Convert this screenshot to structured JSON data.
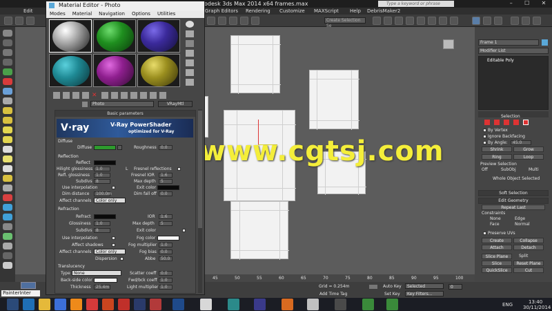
{
  "window": {
    "title": "odesk 3ds Max  2014 x64      frames.max",
    "search_placeholder": "Type a keyword or phrase",
    "min": "–",
    "max": "☐",
    "close": "✕"
  },
  "main_menu": [
    "Edit",
    "Graph Editors",
    "Rendering",
    "Customize",
    "MAXScript",
    "Help",
    "DebrisMaker2"
  ],
  "selection_set": "Create Selection Se",
  "material_editor": {
    "title": "Material Editor - Photo",
    "menu": [
      "Modes",
      "Material",
      "Navigation",
      "Options",
      "Utilities"
    ],
    "material_name": "Photo",
    "material_type": "VRayMtl",
    "rollup_basic": "Basic parameters",
    "banner_logo": "V·ray",
    "banner_title": "V-Ray PowerShader",
    "banner_sub": "optimized for V-Ray",
    "diffuse": {
      "section": "Diffuse",
      "label": "Diffuse",
      "color": "#2e9b2e",
      "roughness_label": "Roughness",
      "roughness": "0.0"
    },
    "reflection": {
      "section": "Reflection",
      "reflect": "Reflect",
      "hilight_gloss": "Hilight glossiness",
      "hilight_val": "1.0",
      "lock": "L",
      "fresnel": "Fresnel reflections",
      "refl_gloss": "Refl. glossiness",
      "refl_val": "1.0",
      "fresnel_ior": "Fresnel IOR",
      "fresnel_ior_val": "1.6",
      "subdivs": "Subdivs",
      "subdivs_val": "8",
      "max_depth": "Max depth",
      "max_depth_val": "5",
      "use_interp": "Use interpolation",
      "exit_color": "Exit color",
      "dim_distance": "Dim distance",
      "dim_val": "100.0m",
      "dim_falloff": "Dim fall off",
      "dim_falloff_val": "0.0",
      "affect_channels": "Affect channels",
      "affect_val": "Color only"
    },
    "refraction": {
      "section": "Refraction",
      "refract": "Refract",
      "ior": "IOR",
      "ior_val": "1.6",
      "glossiness": "Glossiness",
      "gloss_val": "1.0",
      "max_depth": "Max depth",
      "max_depth_val": "5",
      "subdivs": "Subdivs",
      "subdivs_val": "8",
      "exit_color": "Exit color",
      "use_interp": "Use interpolation",
      "fog_color": "Fog color",
      "affect_shadows": "Affect shadows",
      "fog_mult": "Fog multiplier",
      "fog_mult_val": "1.0",
      "affect_channels": "Affect channels",
      "affect_val": "Color only",
      "fog_bias": "Fog bias",
      "fog_bias_val": "0.0",
      "dispersion": "Dispersion",
      "abbe": "Abbe",
      "abbe_val": "50.0"
    },
    "translucency": {
      "section": "Translucency",
      "type": "Type",
      "type_val": "None",
      "scatter": "Scatter coeff",
      "scatter_val": "0.0",
      "back_side": "Back-side color",
      "fwd_bck": "Fwd/bck coeff",
      "fwd_val": "1.0",
      "thickness": "Thickness",
      "thickness_val": "25.4m",
      "light_mult": "Light multiplier",
      "light_val": "1.0"
    }
  },
  "command_panel": {
    "object_name": "Frame 1",
    "modifier_list": "Modifier List",
    "stack_item": "Editable Poly",
    "selection_title": "Selection",
    "by_vertex": "By Vertex",
    "ignore_backfacing": "Ignore Backfacing",
    "by_angle": "By Angle:",
    "by_angle_val": "45.0",
    "shrink": "Shrink",
    "grow": "Grow",
    "ring": "Ring",
    "loop": "Loop",
    "preview_sel": "Preview Selection",
    "off": "Off",
    "subobj": "SubObj",
    "multi": "Multi",
    "whole_object": "Whole Object Selected",
    "soft_selection": "Soft Selection",
    "edit_geometry": "Edit Geometry",
    "repeat_last": "Repeat Last",
    "constraints": "Constraints",
    "none": "None",
    "edge": "Edge",
    "face": "Face",
    "normal": "Normal",
    "preserve_uvs": "Preserve UVs",
    "create": "Create",
    "collapse": "Collapse",
    "attach": "Attach",
    "detach": "Detach",
    "slice_plane": "Slice Plane",
    "split": "Split",
    "slice": "Slice",
    "reset_plane": "Reset Plane",
    "quickslice": "QuickSlice",
    "cut": "Cut"
  },
  "timeline": {
    "ticks": [
      "45",
      "50",
      "55",
      "60",
      "65",
      "70",
      "75",
      "80",
      "85",
      "90",
      "95",
      "100"
    ]
  },
  "status": {
    "prompt": "PainterInter",
    "grid": "Grid = 0.254m",
    "auto_key": "Auto Key",
    "selected": "Selected",
    "set_key": "Set Key",
    "key_filters": "Key Filters...",
    "add_time_tag": "Add Time Tag",
    "frame": "0"
  },
  "taskbar": {
    "lang": "ENG",
    "time": "13:40",
    "date": "30/11/2014"
  },
  "watermark": "www.cgtsj.com",
  "colors": {
    "sphere1": "#c8c8c8",
    "sphere2": "#1f8f1f",
    "sphere3": "#3b2a9b",
    "sphere4": "#1f8a95",
    "sphere5": "#8f1f8f",
    "sphere6": "#9b8f1f",
    "accent_red": "#cc2222"
  }
}
